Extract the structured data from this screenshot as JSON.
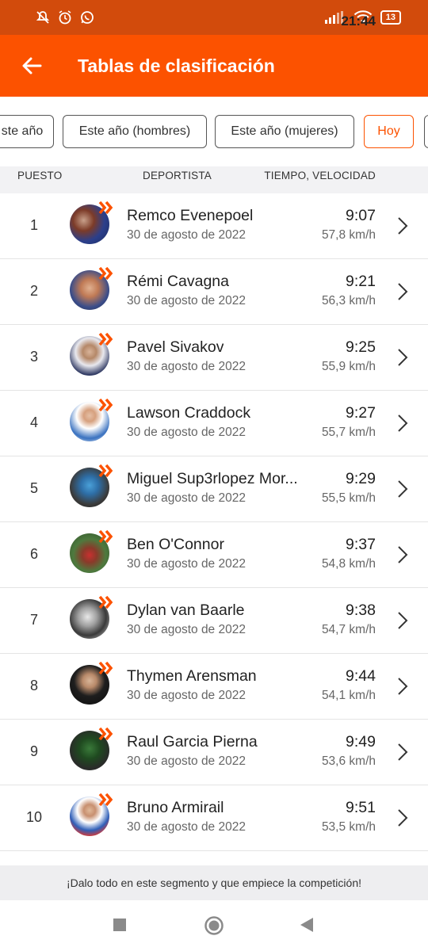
{
  "status_bar": {
    "time": "21:44",
    "battery": "13"
  },
  "app_bar": {
    "title": "Tablas de clasificación"
  },
  "filters": [
    {
      "label": "ste año",
      "active": false
    },
    {
      "label": "Este año (hombres)",
      "active": false
    },
    {
      "label": "Este año (mujeres)",
      "active": false
    },
    {
      "label": "Hoy",
      "active": true
    }
  ],
  "table_header": {
    "rank": "PUESTO",
    "athlete": "DEPORTISTA",
    "time": "TIEMPO, VELOCIDAD"
  },
  "rows": [
    {
      "rank": "1",
      "name": "Remco Evenepoel",
      "date": "30 de agosto de 2022",
      "time": "9:07",
      "speed": "57,8 km/h"
    },
    {
      "rank": "2",
      "name": "Rémi Cavagna",
      "date": "30 de agosto de 2022",
      "time": "9:21",
      "speed": "56,3 km/h"
    },
    {
      "rank": "3",
      "name": "Pavel Sivakov",
      "date": "30 de agosto de 2022",
      "time": "9:25",
      "speed": "55,9 km/h"
    },
    {
      "rank": "4",
      "name": "Lawson Craddock",
      "date": "30 de agosto de 2022",
      "time": "9:27",
      "speed": "55,7 km/h"
    },
    {
      "rank": "5",
      "name": "Miguel Sup3rlopez Mor...",
      "date": "30 de agosto de 2022",
      "time": "9:29",
      "speed": "55,5 km/h"
    },
    {
      "rank": "6",
      "name": "Ben O'Connor",
      "date": "30 de agosto de 2022",
      "time": "9:37",
      "speed": "54,8 km/h"
    },
    {
      "rank": "7",
      "name": "Dylan van Baarle",
      "date": "30 de agosto de 2022",
      "time": "9:38",
      "speed": "54,7 km/h"
    },
    {
      "rank": "8",
      "name": "Thymen Arensman",
      "date": "30 de agosto de 2022",
      "time": "9:44",
      "speed": "54,1 km/h"
    },
    {
      "rank": "9",
      "name": "Raul Garcia Pierna",
      "date": "30 de agosto de 2022",
      "time": "9:49",
      "speed": "53,6 km/h"
    },
    {
      "rank": "10",
      "name": "Bruno Armirail",
      "date": "30 de agosto de 2022",
      "time": "9:51",
      "speed": "53,5 km/h"
    }
  ],
  "footer": {
    "text": "¡Dalo todo en este segmento y que empiece la competición!"
  },
  "colors": {
    "brand": "#fc5200",
    "status_bar": "#d24b0c"
  },
  "icons": [
    "back-arrow-icon",
    "mute-icon",
    "alarm-icon",
    "whatsapp-icon",
    "signal-icon",
    "wifi-icon",
    "battery-icon",
    "chevron-right-icon",
    "strava-pro-badge-icon"
  ]
}
